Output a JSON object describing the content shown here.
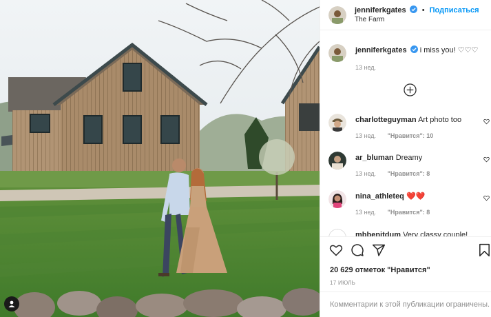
{
  "header": {
    "username": "jenniferkgates",
    "follow_label": "Подписаться",
    "dot": "•",
    "location": "The Farm"
  },
  "caption": {
    "username": "jenniferkgates",
    "text": "i miss you! ♡♡♡",
    "time": "13 нед."
  },
  "comments": [
    {
      "username": "charlotteguyman",
      "text": "Art photo too",
      "time": "13 нед.",
      "likes": "\"Нравится\": 10",
      "reply": ""
    },
    {
      "username": "ar_bluman",
      "text": "Dreamy",
      "time": "13 нед.",
      "likes": "\"Нравится\": 8",
      "reply": ""
    },
    {
      "username": "nina_athleteq",
      "text": "❤️❤️",
      "time": "13 нед.",
      "likes": "\"Нравится\": 8",
      "reply": ""
    },
    {
      "username": "mbbenitdum",
      "text": "Very classy couple!"
    }
  ],
  "post": {
    "likes_total": "20 629 отметок \"Нравится\"",
    "date": "17 ИЮЛЬ",
    "comments_closed": "Комментарии к этой публикации ограничены."
  },
  "colors": {
    "accent": "#0095f6",
    "verified": "#3897f0",
    "heart": "#ed4956",
    "muted": "#8e8e8e"
  },
  "icons": [
    "verified-icon",
    "add-comments-icon",
    "heart-icon",
    "comment-icon",
    "share-icon",
    "bookmark-icon",
    "user-tag-icon"
  ]
}
